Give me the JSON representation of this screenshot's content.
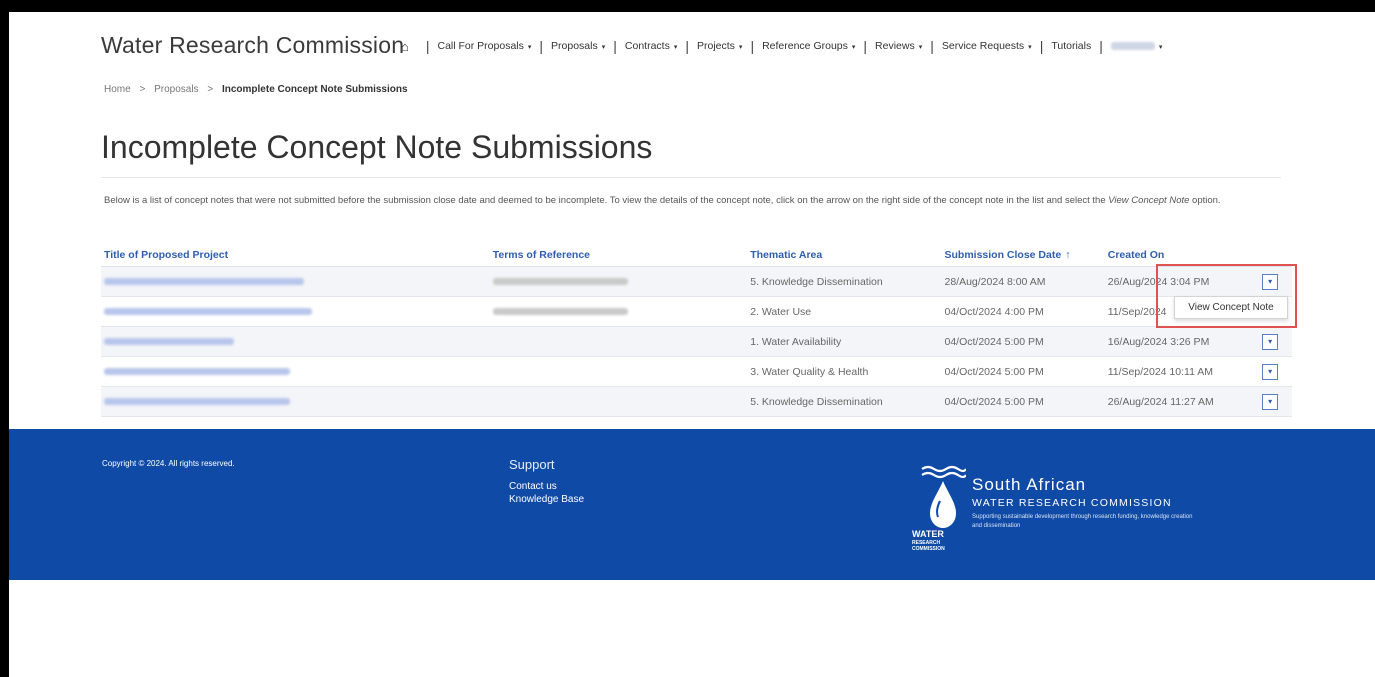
{
  "header": {
    "brand": "Water Research Commission",
    "home_icon": "home-icon",
    "nav": [
      {
        "label": "Call For Proposals",
        "caret": "▾"
      },
      {
        "label": "Proposals",
        "caret": "▾"
      },
      {
        "label": "Contracts",
        "caret": "▾"
      },
      {
        "label": "Projects",
        "caret": "▾"
      },
      {
        "label": "Reference Groups",
        "caret": "▾"
      },
      {
        "label": "Reviews",
        "caret": "▾"
      },
      {
        "label": "Service Requests",
        "caret": "▾"
      },
      {
        "label": "Tutorials",
        "caret": ""
      }
    ],
    "user_caret": "▾"
  },
  "breadcrumb": {
    "home": "Home",
    "proposals": "Proposals",
    "current": "Incomplete Concept Note Submissions",
    "sep": ">"
  },
  "page": {
    "title": "Incomplete Concept Note Submissions",
    "intro_main": "Below is a list of concept notes that were not submitted before the submission close date and deemed to be incomplete. To view the details of the concept note, click on the arrow on the right side of the concept note in the list and select the ",
    "intro_em": "View Concept Note",
    "intro_end": " option."
  },
  "table": {
    "headers": {
      "title": "Title of Proposed Project",
      "terms": "Terms of Reference",
      "thematic": "Thematic Area",
      "close_date": "Submission Close Date",
      "created": "Created On"
    },
    "sort_icon": "↑",
    "rows": [
      {
        "thematic": "5. Knowledge Dissemination",
        "close_date": "28/Aug/2024 8:00 AM",
        "created": "26/Aug/2024 3:04 PM",
        "btn": "▾"
      },
      {
        "thematic": "2. Water Use",
        "close_date": "04/Oct/2024 4:00 PM",
        "created": "11/Sep/2024",
        "btn": "▾"
      },
      {
        "thematic": "1. Water Availability",
        "close_date": "04/Oct/2024 5:00 PM",
        "created": "16/Aug/2024 3:26 PM",
        "btn": "▾"
      },
      {
        "thematic": "3. Water Quality & Health",
        "close_date": "04/Oct/2024 5:00 PM",
        "created": "11/Sep/2024 10:11 AM",
        "btn": "▾"
      },
      {
        "thematic": "5. Knowledge Dissemination",
        "close_date": "04/Oct/2024 5:00 PM",
        "created": "26/Aug/2024 11:27 AM",
        "btn": "▾"
      }
    ]
  },
  "dropdown": {
    "item": "View Concept Note"
  },
  "footer": {
    "copyright": "Copyright © 2024. All rights reserved.",
    "support_heading": "Support",
    "contact": "Contact us",
    "kb": "Knowledge Base",
    "logo_line1": "South African",
    "logo_line2": "WATER RESEARCH COMMISSION",
    "logo_tag": "Supporting sustainable development through research funding, knowledge creation and dissemination",
    "logo_word": "WATER",
    "logo_word_sub": "RESEARCH COMMISSION"
  }
}
